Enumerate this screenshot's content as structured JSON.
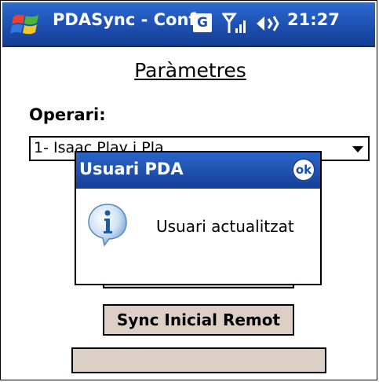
{
  "titlebar": {
    "title": "PDASync - Conf",
    "g_label": "G",
    "clock": "21:27"
  },
  "page": {
    "title": "Paràmetres",
    "operari_label": "Operari:",
    "operari_value": "1- Isaac Play i Pla"
  },
  "buttons": {
    "sync_inicial_remot": "Sync Inicial Remot",
    "empty_button": ""
  },
  "dialog": {
    "title": "Usuari PDA",
    "ok_label": "ok",
    "message": "Usuari actualitzat"
  },
  "colors": {
    "titlebar": "#1c4fb0",
    "button_face": "#dcd0c6"
  }
}
